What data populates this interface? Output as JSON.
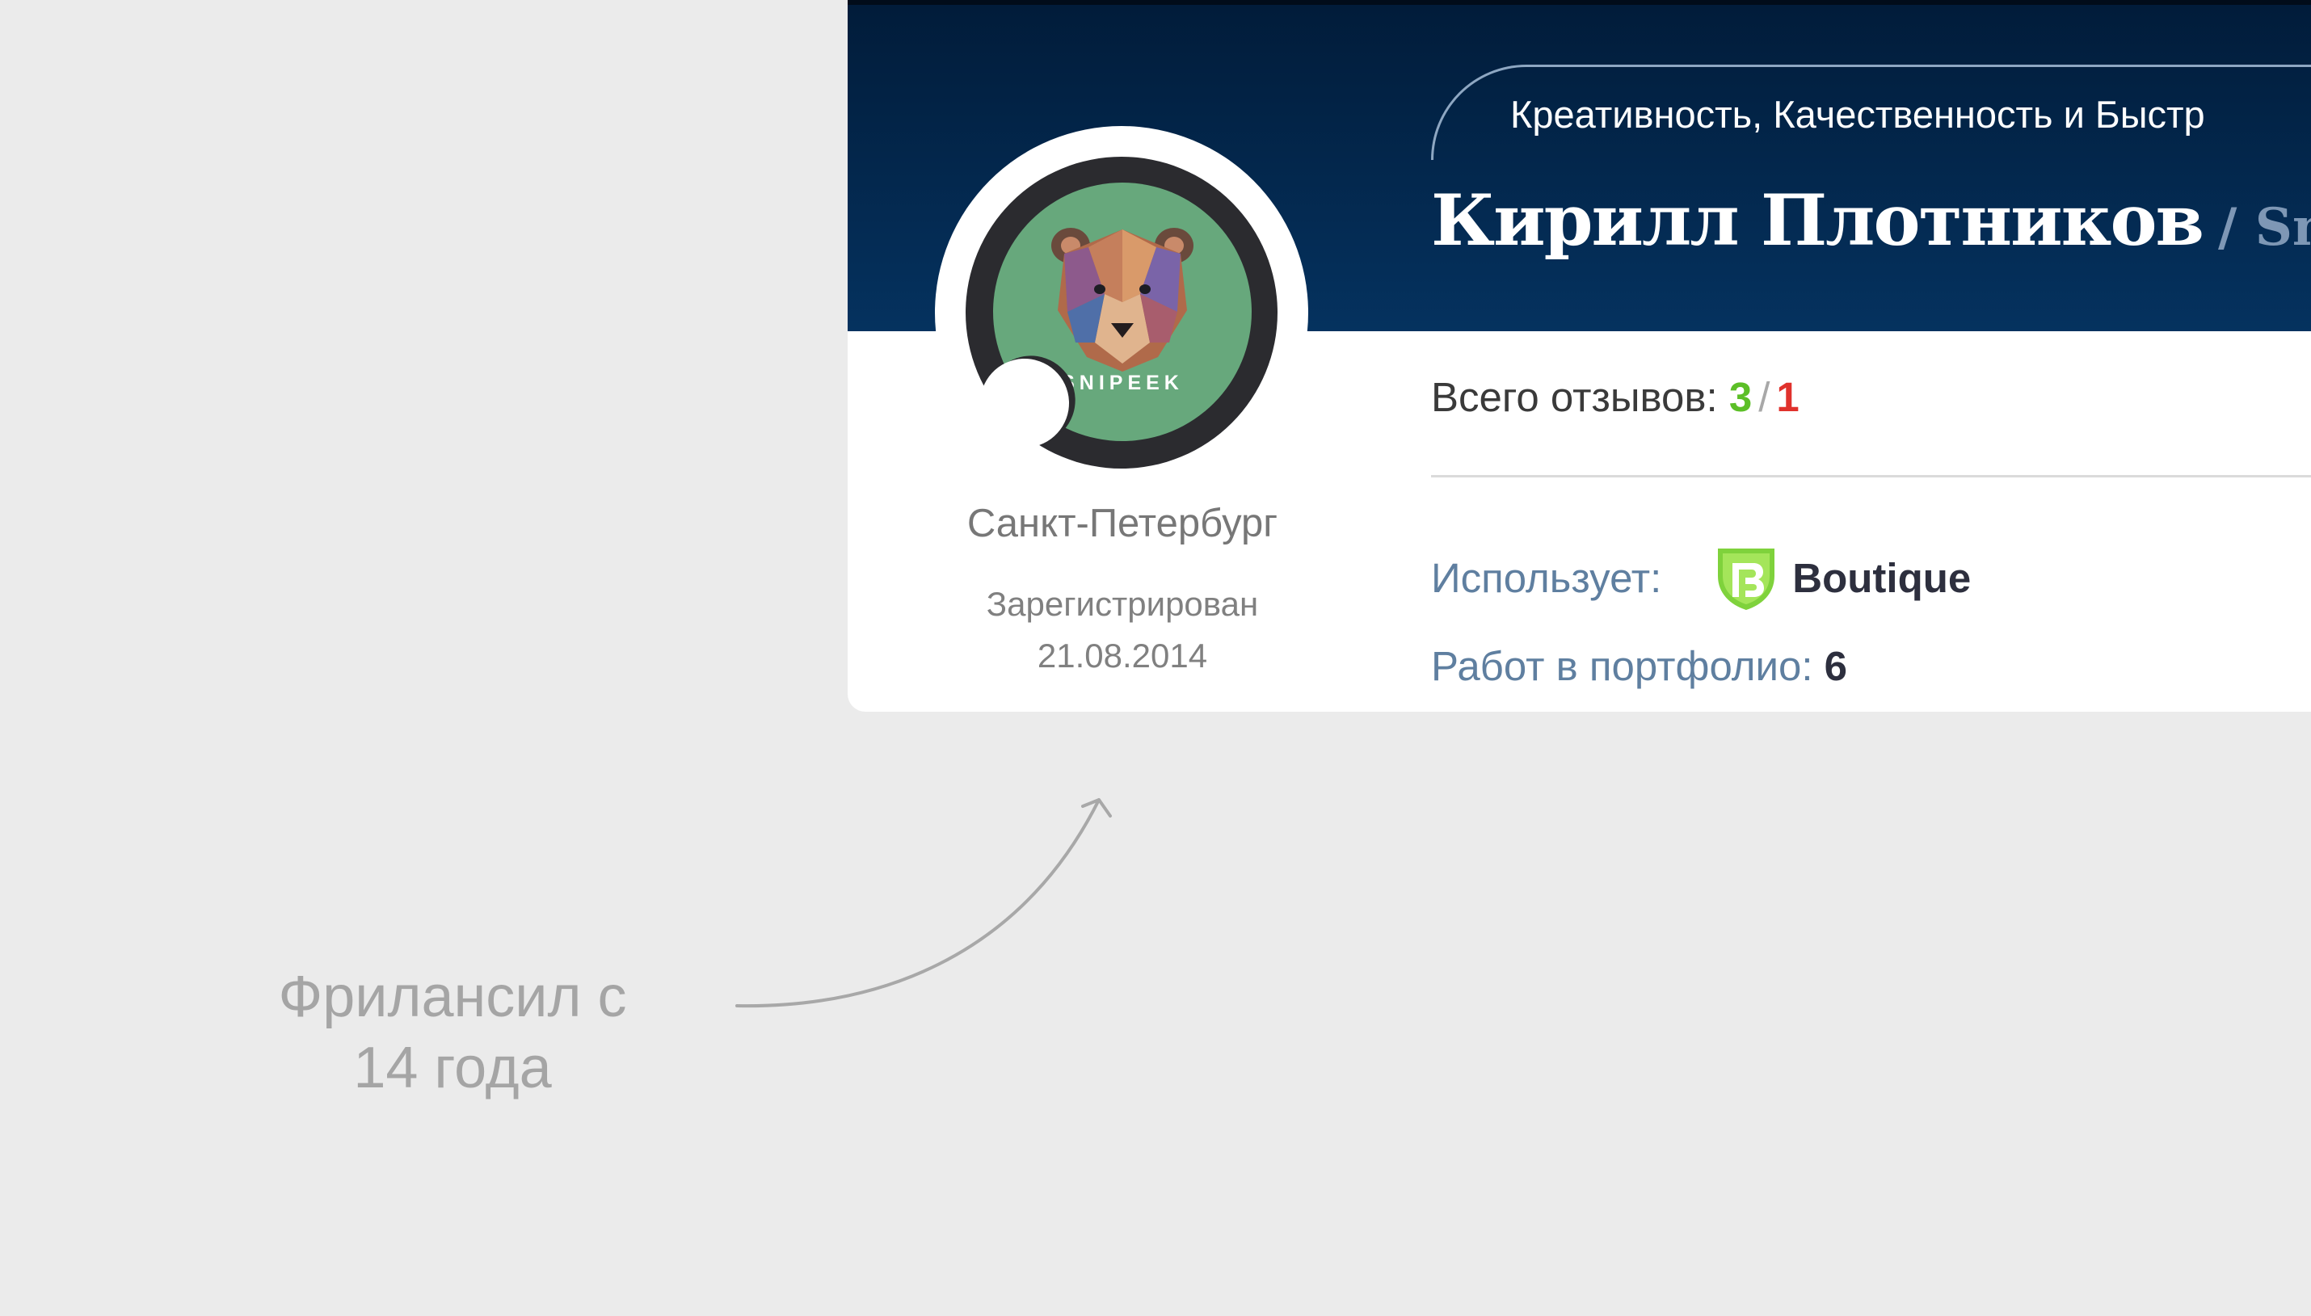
{
  "profile": {
    "tagline": "Креативность, Качественность и Быстр",
    "name": "Кирилл Плотников",
    "nickname": "/ Snip",
    "avatar_text": "SNIPEEK",
    "city": "Санкт-Петербург",
    "registered_label": "Зарегистрирован",
    "registered_date": "21.08.2014"
  },
  "stats": {
    "reviews_label": "Всего отзывов:",
    "reviews_positive": "3",
    "reviews_separator": "/",
    "reviews_negative": "1",
    "uses_label": "Использует:",
    "uses_product": "Boutique",
    "uses_icon": "boutique-shield-icon",
    "portfolio_label": "Работ в портфолио:",
    "portfolio_count": "6"
  },
  "annotation": {
    "line1": "Фрилансил с",
    "line2": "14 года"
  },
  "colors": {
    "background": "#ebebeb",
    "header": "#05325f",
    "positive": "#5cbf27",
    "negative": "#e0312c",
    "label_blue": "#5f7fa0",
    "avatar_green": "#67a87c"
  }
}
